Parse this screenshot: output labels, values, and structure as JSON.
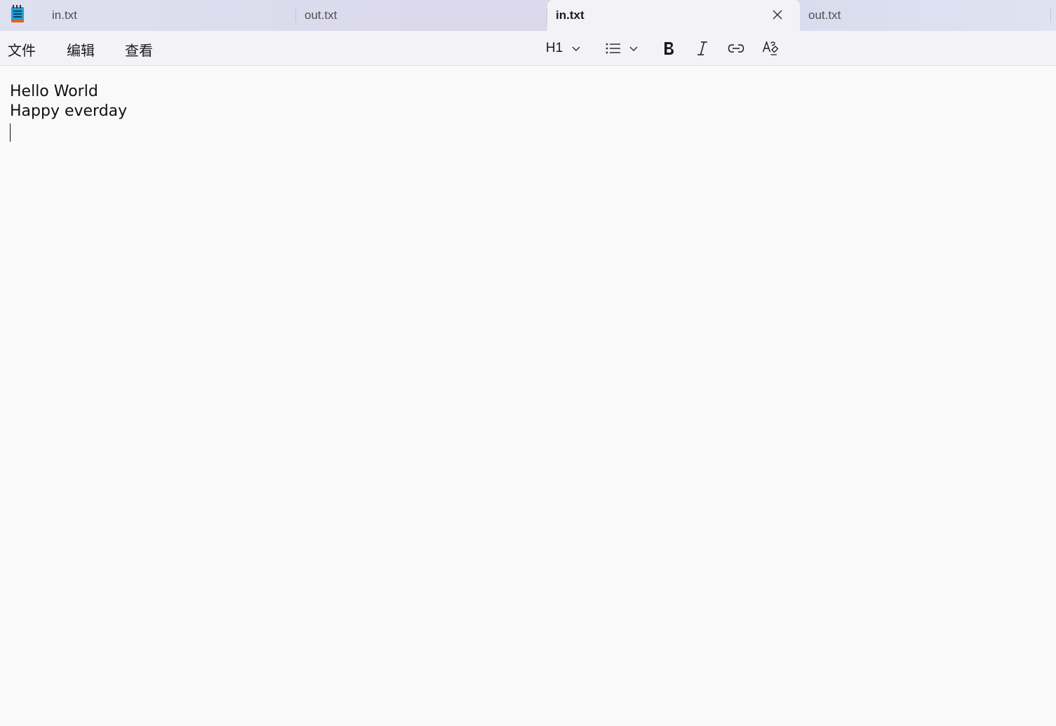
{
  "app": {
    "icon": "notepad-icon"
  },
  "tabs": [
    {
      "label": "in.txt",
      "active": false
    },
    {
      "label": "out.txt",
      "active": false
    },
    {
      "label": "in.txt",
      "active": true
    },
    {
      "label": "out.txt",
      "active": false
    }
  ],
  "menu": {
    "file": "文件",
    "edit": "编辑",
    "view": "查看"
  },
  "toolbar": {
    "heading_label": "H1",
    "heading_icon": "chevron-down-icon",
    "list_icon": "bulleted-list-icon",
    "bold_icon": "bold-icon",
    "italic_icon": "italic-icon",
    "link_icon": "link-icon",
    "clear_format_icon": "clear-formatting-icon"
  },
  "editor": {
    "lines": [
      "Hello World",
      "Happy everday"
    ]
  },
  "colors": {
    "accent_icon": "#1ea0d8",
    "text": "#1a1a1a",
    "background": "#f9f9f9"
  }
}
